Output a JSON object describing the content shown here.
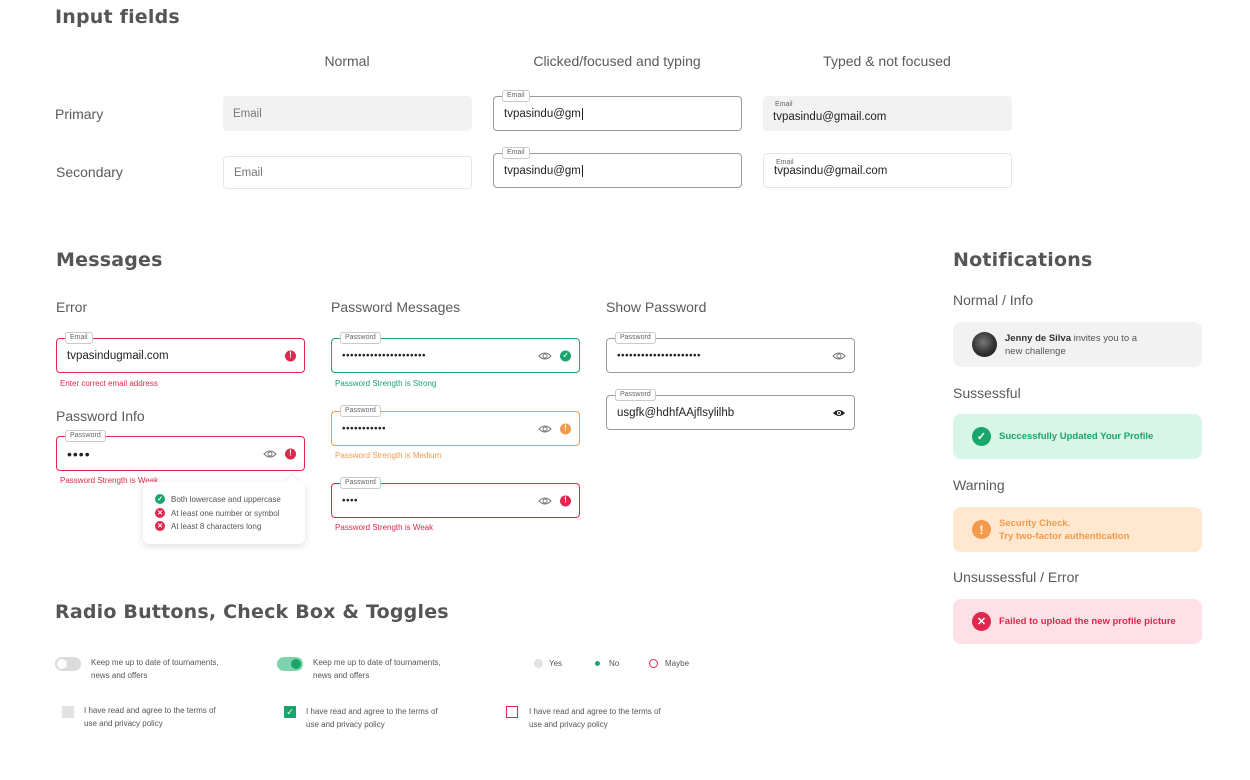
{
  "input_fields": {
    "title": "Input fields",
    "columns": [
      "Normal",
      "Clicked/focused and typing",
      "Typed & not focused"
    ],
    "rows": [
      "Primary",
      "Secondary"
    ],
    "placeholder": "Email",
    "label": "Email",
    "typing_value": "tvpasindu@gm",
    "typed_value": "tvpasindu@gmail.com"
  },
  "messages": {
    "title": "Messages",
    "error": {
      "heading": "Error",
      "label": "Email",
      "value": "tvpasindugmail.com",
      "message": "Enter correct email address"
    },
    "password_info": {
      "heading": "Password Info",
      "label": "Password",
      "value": "••••",
      "message": "Password Strength is Weak",
      "rules": [
        {
          "text": "Both lowercase and uppercase",
          "ok": true
        },
        {
          "text": "At least one number or symbol",
          "ok": false
        },
        {
          "text": "At least 8 characters long",
          "ok": false
        }
      ]
    },
    "password_messages": {
      "heading": "Password Messages",
      "label": "Password",
      "strong_value": "•••••••••••••••••••••",
      "strong_message": "Password Strength is Strong",
      "medium_value": "•••••••••••",
      "medium_message": "Password Strength is Medium",
      "weak_value": "••••",
      "weak_message": "Password Strength is Weak"
    },
    "show_password": {
      "heading": "Show Password",
      "label": "Password",
      "hidden_value": "•••••••••••••••••••••",
      "shown_value": "usgfk@hdhfAAjflsylilhb"
    }
  },
  "notifications": {
    "title": "Notifications",
    "info": {
      "heading": "Normal / Info",
      "name": "Jenny de Silva",
      "text_rest": " invites you to a",
      "text_line2": "new challenge"
    },
    "success": {
      "heading": "Sussessful",
      "text": "Successfully Updated Your Profile",
      "color": "#19a56b"
    },
    "warning": {
      "heading": "Warning",
      "line1": "Security Check.",
      "line2": "Try two-factor authentication",
      "color": "#f39a4d"
    },
    "error": {
      "heading": "Unsussessful / Error",
      "text": "Failed to upload the new profile picture",
      "color": "#e0284f"
    }
  },
  "controls": {
    "title": "Radio Buttons, Check Box & Toggles",
    "toggle_line1": "Keep me up to date of tournaments,",
    "toggle_line2": "news and offers",
    "toggle_off": false,
    "toggle_on": true,
    "radio_options": [
      "Yes",
      "No",
      "Maybe"
    ],
    "radio_selected": "No",
    "checkbox_line1": "I have read and agree to the terms of",
    "checkbox_line2": "use  and privacy policy",
    "checkbox_states": [
      "unchecked",
      "checked",
      "error"
    ]
  },
  "colors": {
    "accent_green": "#19a56b",
    "error_red": "#e0284f",
    "warning_orange": "#f39a4d",
    "field_gray": "#f2f2f2"
  },
  "icons": [
    "eye-icon",
    "eye-open-icon",
    "error-icon",
    "check-icon",
    "warning-icon",
    "cross-icon",
    "avatar"
  ]
}
